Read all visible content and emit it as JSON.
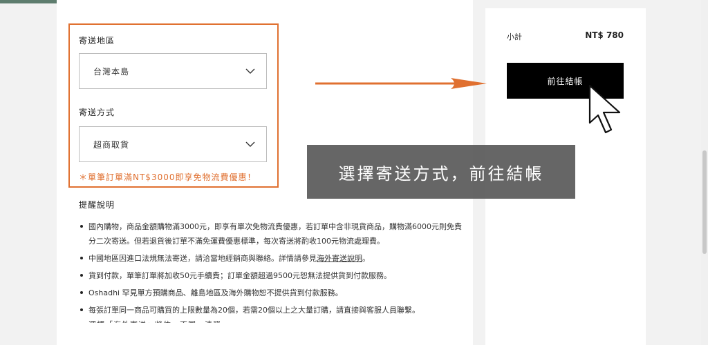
{
  "shipping": {
    "region_label": "寄送地區",
    "region_value": "台灣本島",
    "method_label": "寄送方式",
    "method_value": "超商取貨",
    "promo": "＊單筆訂單滿NT$3000即享免物流費優惠！"
  },
  "notes": {
    "title": "提醒說明",
    "items": [
      "國內購物，商品金額購物滿3000元，即享有單次免物流費優惠，若訂單中含非現貨商品，購物滿6000元則免費分二次寄送。但若退貨後訂單不滿免運費優惠標準，每次寄送將酌收100元物流處理費。",
      "中國地區因進口法規無法寄送，請洽當地經銷商與聯絡。詳情請參見",
      "貨到付款，單筆訂單將加收50元手續費；訂單金額超過9500元恕無法提供貨到付款服務。",
      "Oshadhi 罕見單方預購商品、離島地區及海外購物恕不提供貨到付款服務。",
      "每張訂單同一商品可購買的上限數量為20個，若需20個以上之大量訂購，請直接與客服人員聯繫。"
    ],
    "overseas_link": "海外寄送說明",
    "link_suffix": "。",
    "partial_next": "選擇「海外寄送」將依…不同…清單…"
  },
  "summary": {
    "subtotal_label": "小計",
    "subtotal_value": "NT$ 780",
    "checkout_label": "前往結帳"
  },
  "callout": {
    "text": "選擇寄送方式，前往結帳"
  },
  "colors": {
    "accent": "#e07030",
    "topbar": "#5e7d6e",
    "button": "#000000"
  },
  "icons": {
    "select_chevron": "chevron-down-icon",
    "pointer": "mouse-pointer-icon",
    "arrow": "arrow-right-icon"
  }
}
